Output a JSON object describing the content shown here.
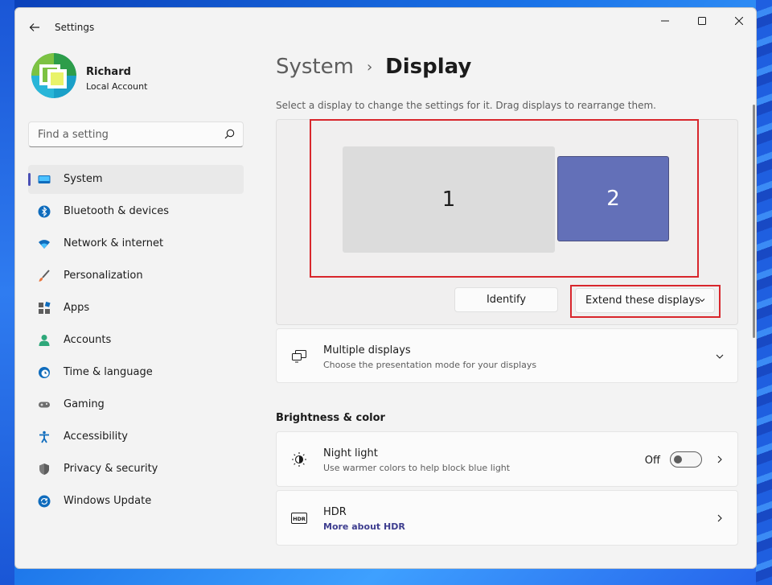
{
  "window": {
    "title": "Settings"
  },
  "profile": {
    "name": "Richard",
    "account_type": "Local Account"
  },
  "search": {
    "placeholder": "Find a setting"
  },
  "sidebar": {
    "items": [
      {
        "label": "System",
        "icon": "monitor-icon",
        "active": true
      },
      {
        "label": "Bluetooth & devices",
        "icon": "bluetooth-icon"
      },
      {
        "label": "Network & internet",
        "icon": "wifi-icon"
      },
      {
        "label": "Personalization",
        "icon": "brush-icon"
      },
      {
        "label": "Apps",
        "icon": "apps-icon"
      },
      {
        "label": "Accounts",
        "icon": "person-icon"
      },
      {
        "label": "Time & language",
        "icon": "globe-clock-icon"
      },
      {
        "label": "Gaming",
        "icon": "gamepad-icon"
      },
      {
        "label": "Accessibility",
        "icon": "accessibility-icon"
      },
      {
        "label": "Privacy & security",
        "icon": "shield-icon"
      },
      {
        "label": "Windows Update",
        "icon": "update-icon"
      }
    ]
  },
  "breadcrumb": {
    "parent": "System",
    "separator": "›",
    "current": "Display"
  },
  "display": {
    "hint": "Select a display to change the settings for it. Drag displays to rearrange them.",
    "monitors": [
      {
        "label": "1",
        "selected": false
      },
      {
        "label": "2",
        "selected": true
      }
    ],
    "identify_label": "Identify",
    "mode_value": "Extend these displays"
  },
  "multiple_displays": {
    "title": "Multiple displays",
    "subtitle": "Choose the presentation mode for your displays"
  },
  "brightness_section": {
    "title": "Brightness & color"
  },
  "night_light": {
    "title": "Night light",
    "subtitle": "Use warmer colors to help block blue light",
    "state_label": "Off",
    "on": false
  },
  "hdr": {
    "title": "HDR",
    "link": "More about HDR"
  },
  "colors": {
    "accent": "#4a4fb5",
    "selected_monitor": "#6370b8",
    "highlight_annotation": "#d8262c"
  }
}
